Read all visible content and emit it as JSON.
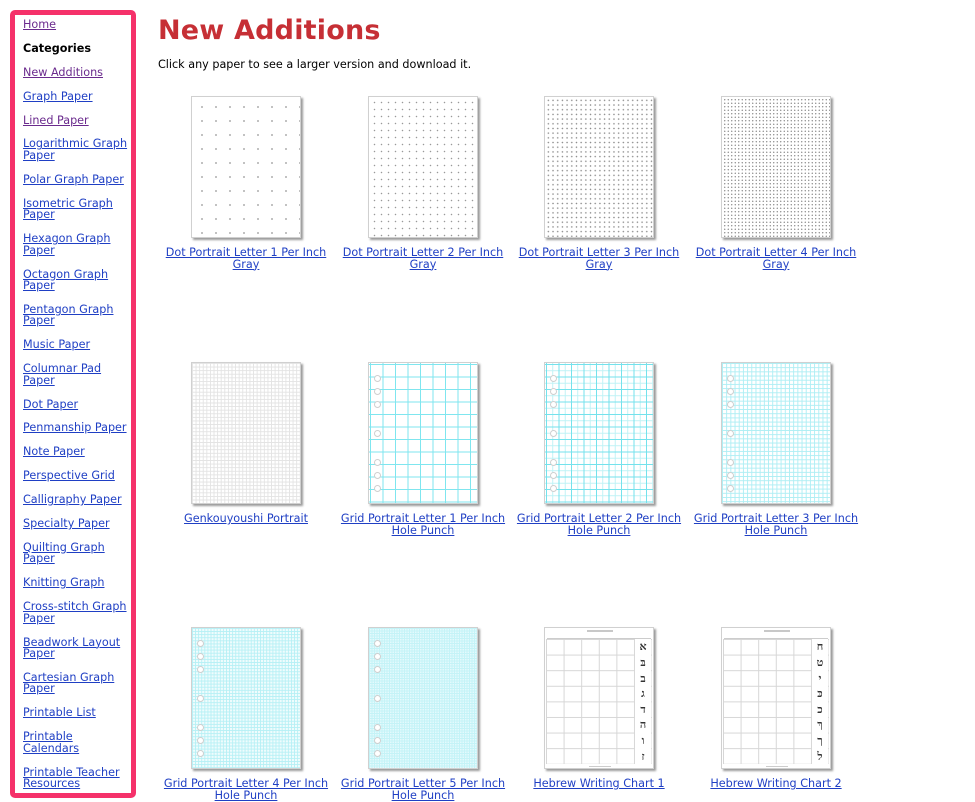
{
  "sidebar": {
    "items": [
      {
        "label": "Home",
        "type": "link",
        "visited": true
      },
      {
        "label": "Categories",
        "type": "heading"
      },
      {
        "label": "New Additions",
        "type": "link",
        "visited": true
      },
      {
        "label": "Graph Paper",
        "type": "link",
        "visited": false
      },
      {
        "label": "Lined Paper",
        "type": "link",
        "visited": true
      },
      {
        "label": "Logarithmic Graph Paper",
        "type": "link",
        "visited": false
      },
      {
        "label": "Polar Graph Paper",
        "type": "link",
        "visited": false
      },
      {
        "label": "Isometric Graph Paper",
        "type": "link",
        "visited": false
      },
      {
        "label": "Hexagon Graph Paper",
        "type": "link",
        "visited": false
      },
      {
        "label": "Octagon Graph Paper",
        "type": "link",
        "visited": false
      },
      {
        "label": "Pentagon Graph Paper",
        "type": "link",
        "visited": false
      },
      {
        "label": "Music Paper",
        "type": "link",
        "visited": false
      },
      {
        "label": "Columnar Pad Paper",
        "type": "link",
        "visited": false
      },
      {
        "label": "Dot Paper",
        "type": "link",
        "visited": false
      },
      {
        "label": "Penmanship Paper",
        "type": "link",
        "visited": false
      },
      {
        "label": "Note Paper",
        "type": "link",
        "visited": false
      },
      {
        "label": "Perspective Grid",
        "type": "link",
        "visited": false
      },
      {
        "label": "Calligraphy Paper",
        "type": "link",
        "visited": false
      },
      {
        "label": "Specialty Paper",
        "type": "link",
        "visited": false
      },
      {
        "label": "Quilting Graph Paper",
        "type": "link",
        "visited": false
      },
      {
        "label": "Knitting Graph",
        "type": "link",
        "visited": false
      },
      {
        "label": "Cross-stitch Graph Paper",
        "type": "link",
        "visited": false
      },
      {
        "label": "Beadwork Layout Paper",
        "type": "link",
        "visited": false
      },
      {
        "label": "Cartesian Graph Paper",
        "type": "link",
        "visited": false
      },
      {
        "label": "Printable List",
        "type": "link",
        "visited": false
      },
      {
        "label": "Printable Calendars",
        "type": "link",
        "visited": false
      },
      {
        "label": "Printable Teacher Resources",
        "type": "link",
        "visited": false
      }
    ]
  },
  "main": {
    "title": "New Additions",
    "intro": "Click any paper to see a larger version and download it.",
    "papers": [
      {
        "caption": "Dot Portrait Letter 1 Per Inch Gray",
        "thumbnail": "dot-paper-1"
      },
      {
        "caption": "Dot Portrait Letter 2 Per Inch Gray",
        "thumbnail": "dot-paper-2"
      },
      {
        "caption": "Dot Portrait Letter 3 Per Inch Gray",
        "thumbnail": "dot-paper-3"
      },
      {
        "caption": "Dot Portrait Letter 4 Per Inch Gray",
        "thumbnail": "dot-paper-4"
      },
      {
        "caption": "Genkouyoushi Portrait",
        "thumbnail": "genkouyoushi"
      },
      {
        "caption": "Grid Portrait Letter 1 Per Inch Hole Punch",
        "thumbnail": "grid-hole-punch-1"
      },
      {
        "caption": "Grid Portrait Letter 2 Per Inch Hole Punch",
        "thumbnail": "grid-hole-punch-2"
      },
      {
        "caption": "Grid Portrait Letter 3 Per Inch Hole Punch",
        "thumbnail": "grid-hole-punch-3"
      },
      {
        "caption": "Grid Portrait Letter 4 Per Inch Hole Punch",
        "thumbnail": "grid-hole-punch-4"
      },
      {
        "caption": "Grid Portrait Letter 5 Per Inch Hole Punch",
        "thumbnail": "grid-hole-punch-5"
      },
      {
        "caption": "Hebrew Writing Chart 1",
        "thumbnail": "hebrew-chart-1",
        "letters": [
          "א",
          "בּ",
          "ב",
          "ג",
          "ד",
          "ה",
          "ו",
          "ז"
        ]
      },
      {
        "caption": "Hebrew Writing Chart 2",
        "thumbnail": "hebrew-chart-2",
        "letters": [
          "ח",
          "ט",
          "י",
          "כּ",
          "כ",
          "ךּ",
          "ך",
          "ל"
        ]
      }
    ]
  },
  "colors": {
    "title_red": "#c62f35",
    "link_blue": "#1f3fc4",
    "link_visited": "#6a2a8d",
    "sidebar_highlight": "#f5316a",
    "grid_cyan": "#7fe6ef"
  }
}
